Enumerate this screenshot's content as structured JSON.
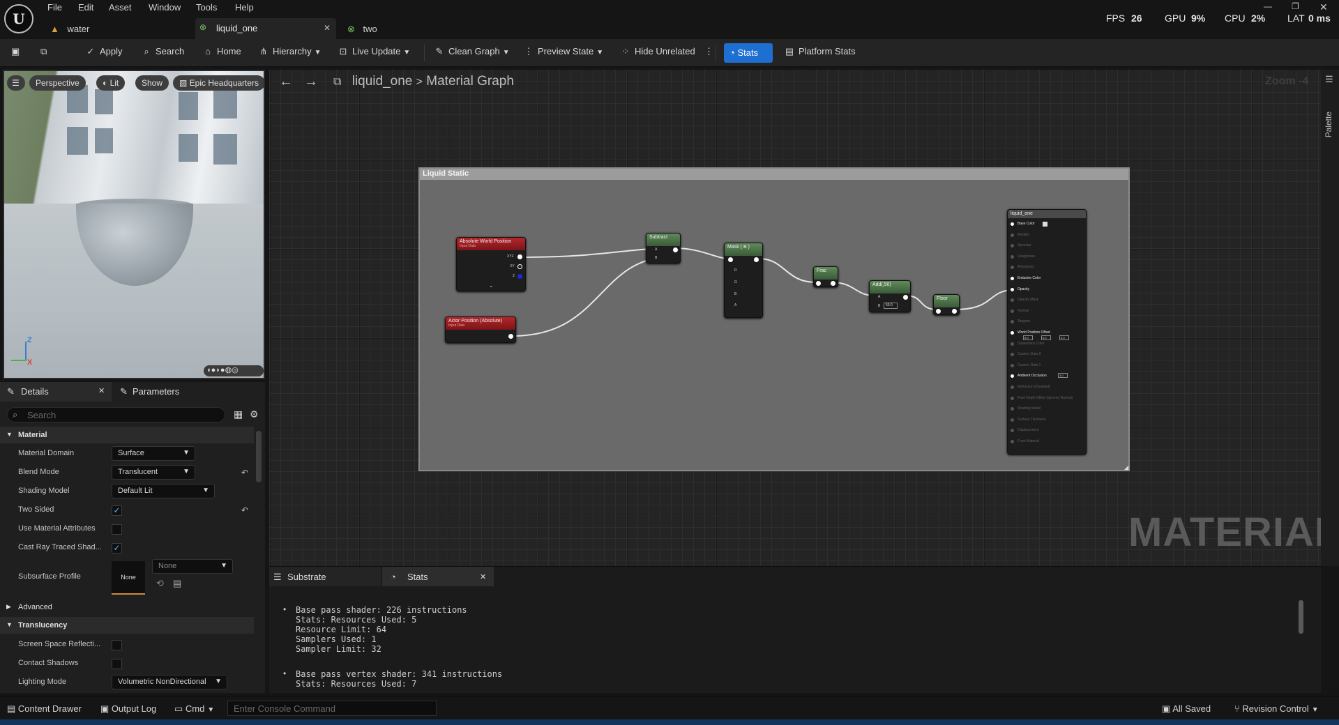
{
  "menu": [
    "File",
    "Edit",
    "Asset",
    "Window",
    "Tools",
    "Help"
  ],
  "tabs": [
    {
      "label": "water"
    },
    {
      "label": "liquid_one"
    },
    {
      "label": "two"
    }
  ],
  "perf": {
    "fps_label": "FPS",
    "fps": "26",
    "gpu_label": "GPU",
    "gpu": "9%",
    "cpu_label": "CPU",
    "cpu": "2%",
    "lat_label": "LAT",
    "lat": "0 ms"
  },
  "toolbar": {
    "apply": "Apply",
    "search": "Search",
    "home": "Home",
    "hierarchy": "Hierarchy",
    "live_update": "Live Update",
    "clean_graph": "Clean Graph",
    "preview_state": "Preview State",
    "hide_unrelated": "Hide Unrelated",
    "stats": "Stats",
    "platform_stats": "Platform Stats"
  },
  "viewport": {
    "perspective": "Perspective",
    "lit": "Lit",
    "show": "Show",
    "scene": "Epic Headquarters",
    "axis_z": "Z",
    "axis_x": "X"
  },
  "details": {
    "tab_details": "Details",
    "tab_parameters": "Parameters",
    "search_placeholder": "Search",
    "cat_material": "Material",
    "cat_advanced": "Advanced",
    "cat_translucency": "Translucency",
    "material_domain_label": "Material Domain",
    "material_domain": "Surface",
    "blend_mode_label": "Blend Mode",
    "blend_mode": "Translucent",
    "shading_model_label": "Shading Model",
    "shading_model": "Default Lit",
    "two_sided_label": "Two Sided",
    "use_attrs_label": "Use Material Attributes",
    "cast_rt_label": "Cast Ray Traced Shad...",
    "subsurface_label": "Subsurface Profile",
    "subsurface_thumb": "None",
    "subsurface_value": "None",
    "ssr_label": "Screen Space Reflecti...",
    "contact_label": "Contact Shadows",
    "lighting_label": "Lighting Mode",
    "lighting_value": "Volumetric NonDirectional"
  },
  "graph": {
    "crumb_asset": "liquid_one",
    "crumb_sep": ">",
    "crumb_graph": "Material Graph",
    "zoom": "Zoom -4",
    "watermark": "MATERIAL",
    "comment": "Liquid Static",
    "palette": "Palette",
    "nodes": {
      "abs_world": "Absolute World Position",
      "abs_world_sub": "Input Data",
      "actor_pos": "Actor Position (Absolute)",
      "actor_pos_sub": "Input Data",
      "subtract": "Subtract",
      "mask": "Mask ( B )",
      "frac": "Frac",
      "add": "Add(,50)",
      "floor": "Floor",
      "add_b": "50.0",
      "result": "liquid_one"
    },
    "pins": {
      "xyz": "XYZ",
      "xy": "XY",
      "z": "Z",
      "a": "A",
      "b": "B",
      "r": "R",
      "g": "G",
      "bb": "B",
      "aa": "A"
    },
    "material_pins": [
      {
        "label": "Base Color",
        "on": true
      },
      {
        "label": "Metallic",
        "on": false
      },
      {
        "label": "Specular",
        "on": false
      },
      {
        "label": "Roughness",
        "on": false
      },
      {
        "label": "Anisotropy",
        "on": false
      },
      {
        "label": "Emissive Color",
        "on": true
      },
      {
        "label": "Opacity",
        "on": true
      },
      {
        "label": "Opacity Mask",
        "on": false
      },
      {
        "label": "Normal",
        "on": false
      },
      {
        "label": "Tangent",
        "on": false
      },
      {
        "label": "World Position Offset",
        "on": true
      },
      {
        "label": "Subsurface Color",
        "on": false
      },
      {
        "label": "Custom Data 0",
        "on": false
      },
      {
        "label": "Custom Data 1",
        "on": false
      },
      {
        "label": "Ambient Occlusion",
        "on": true
      },
      {
        "label": "Refraction (Disabled)",
        "on": false
      },
      {
        "label": "Pixel Depth Offset (Ignored Normal)",
        "on": false
      },
      {
        "label": "Shading Model",
        "on": false
      },
      {
        "label": "Surface Thickness",
        "on": false
      },
      {
        "label": "Displacement",
        "on": false
      },
      {
        "label": "Front Material",
        "on": false
      }
    ],
    "wpo_x": "0.0",
    "wpo_y": "0.0",
    "wpo_z": "0.0",
    "ao_val": "1.0"
  },
  "bottom": {
    "tab_substrate": "Substrate",
    "tab_stats": "Stats",
    "lines": [
      "Base pass shader: 226 instructions",
      "Stats: Resources Used: 5",
      "Resource Limit: 64",
      "Samplers Used: 1",
      "Sampler Limit: 32",
      "Base pass vertex shader: 341 instructions",
      "Stats: Resources Used: 7"
    ]
  },
  "status": {
    "content_drawer": "Content Drawer",
    "output_log": "Output Log",
    "cmd": "Cmd",
    "console_placeholder": "Enter Console Command",
    "all_saved": "All Saved",
    "revision": "Revision Control"
  }
}
